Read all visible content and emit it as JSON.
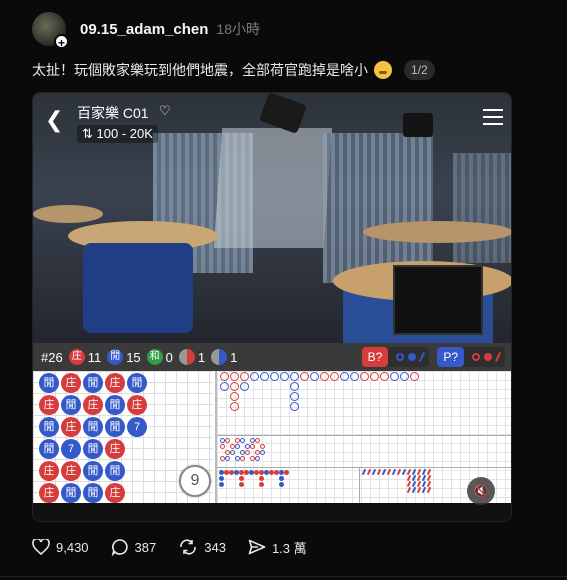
{
  "post": {
    "username": "09.15_adam_chen",
    "time": "18小時",
    "caption": "太扯！玩個敗家樂玩到他們地震，全部荷官跑掉是啥小",
    "counter": "1/2"
  },
  "video": {
    "table_name": "百家樂 C01",
    "limits": "100 - 20K",
    "round": "#26",
    "banker_label": "庄",
    "banker_count": "11",
    "player_label": "閒",
    "player_count": "15",
    "tie_label": "和",
    "tie_count": "0",
    "banker_pair_count": "1",
    "player_pair_count": "1",
    "banker_predict": "B?",
    "player_predict": "P?",
    "shoe_count": "9"
  },
  "bead_road": [
    [
      "閒",
      "庄",
      "閒",
      "庄",
      "閒"
    ],
    [
      "庄",
      "閒",
      "庄",
      "閒",
      "庄"
    ],
    [
      "閒",
      "庄",
      "閒",
      "閒",
      "7"
    ],
    [
      "閒",
      "7",
      "閒",
      "庄",
      ""
    ],
    [
      "庄",
      "庄",
      "閒",
      "閒",
      ""
    ],
    [
      "庄",
      "閒",
      "閒",
      "庄",
      ""
    ]
  ],
  "actions": {
    "likes": "9,430",
    "comments": "387",
    "reposts": "343",
    "shares": "1.3 萬"
  },
  "colors": {
    "banker": "#d63c3c",
    "player": "#3559c8",
    "tie": "#2f9e46"
  }
}
